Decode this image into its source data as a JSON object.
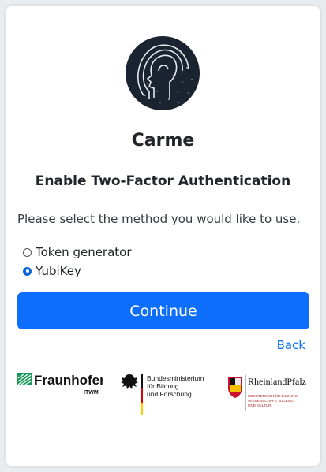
{
  "app": {
    "title": "Carme"
  },
  "form": {
    "heading": "Enable Two-Factor Authentication",
    "prompt": "Please select the method you would like to use.",
    "options": [
      {
        "label": "Token generator",
        "selected": false
      },
      {
        "label": "YubiKey",
        "selected": true
      }
    ],
    "continue_label": "Continue",
    "back_label": "Back"
  },
  "footer": {
    "fraunhofer": {
      "name": "Fraunhofer",
      "sub": "ITWM"
    },
    "bmbf": {
      "line1": "Bundesministerium",
      "line2": "für Bildung",
      "line3": "und Forschung"
    },
    "rlp": {
      "name": "RheinlandPfalz",
      "sub1": "MINISTERIUM FÜR BILDUNG,",
      "sub2": "WISSENSCHAFT, JUGEND",
      "sub3": "UND KULTUR"
    }
  },
  "colors": {
    "primary": "#0d6efd",
    "logo_bg": "#1a2330"
  }
}
